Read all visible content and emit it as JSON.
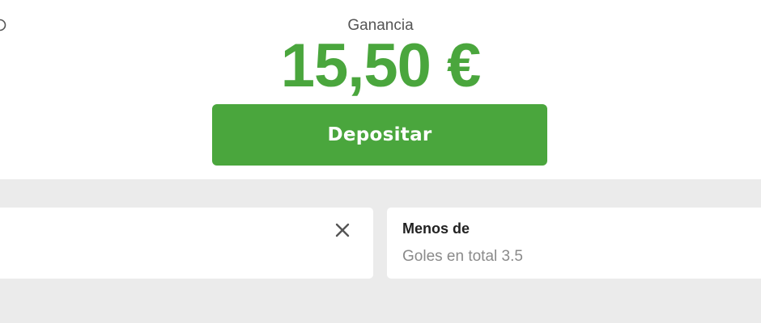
{
  "summary": {
    "gain_label": "Ganancia",
    "gain_amount": "15,50 €",
    "deposit_label": "Depositar",
    "accent_color": "#4aa63d"
  },
  "selection": {
    "title": "Menos de",
    "subtitle": "Goles en total 3.5"
  },
  "icons": {
    "top_left": "partial-circle-icon",
    "close": "close-icon"
  }
}
